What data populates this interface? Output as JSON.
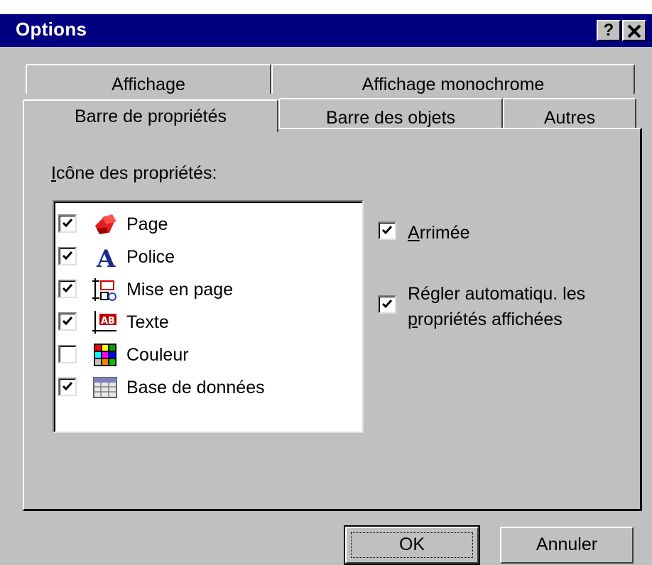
{
  "window": {
    "title": "Options",
    "help_label": "?",
    "close_label": "✕"
  },
  "tabs": [
    {
      "label": "Affichage"
    },
    {
      "label": "Affichage monochrome"
    },
    {
      "label": "Barre de propriétés",
      "active": true
    },
    {
      "label": "Barre des objets"
    },
    {
      "label": "Autres"
    }
  ],
  "panel": {
    "list_label_first": "I",
    "list_label_rest": "cône des propriétés:",
    "items": [
      {
        "label": "Page",
        "checked": true,
        "icon": "page-icon"
      },
      {
        "label": "Police",
        "checked": true,
        "icon": "font-icon"
      },
      {
        "label": "Mise en page",
        "checked": true,
        "icon": "layout-icon"
      },
      {
        "label": "Texte",
        "checked": true,
        "icon": "text-icon"
      },
      {
        "label": "Couleur",
        "checked": false,
        "icon": "color-palette-icon"
      },
      {
        "label": "Base de données",
        "checked": true,
        "icon": "database-icon"
      }
    ],
    "docked": {
      "first": "A",
      "rest": "rrimée",
      "checked": true
    },
    "autoadjust": {
      "line1": "Régler automatiqu. les",
      "line2_first": "p",
      "line2_rest": "ropriétés affichées",
      "checked": true
    }
  },
  "buttons": {
    "ok": "OK",
    "cancel": "Annuler"
  },
  "colors": {
    "titlebar": "#000080",
    "face": "#c0c0c0"
  }
}
